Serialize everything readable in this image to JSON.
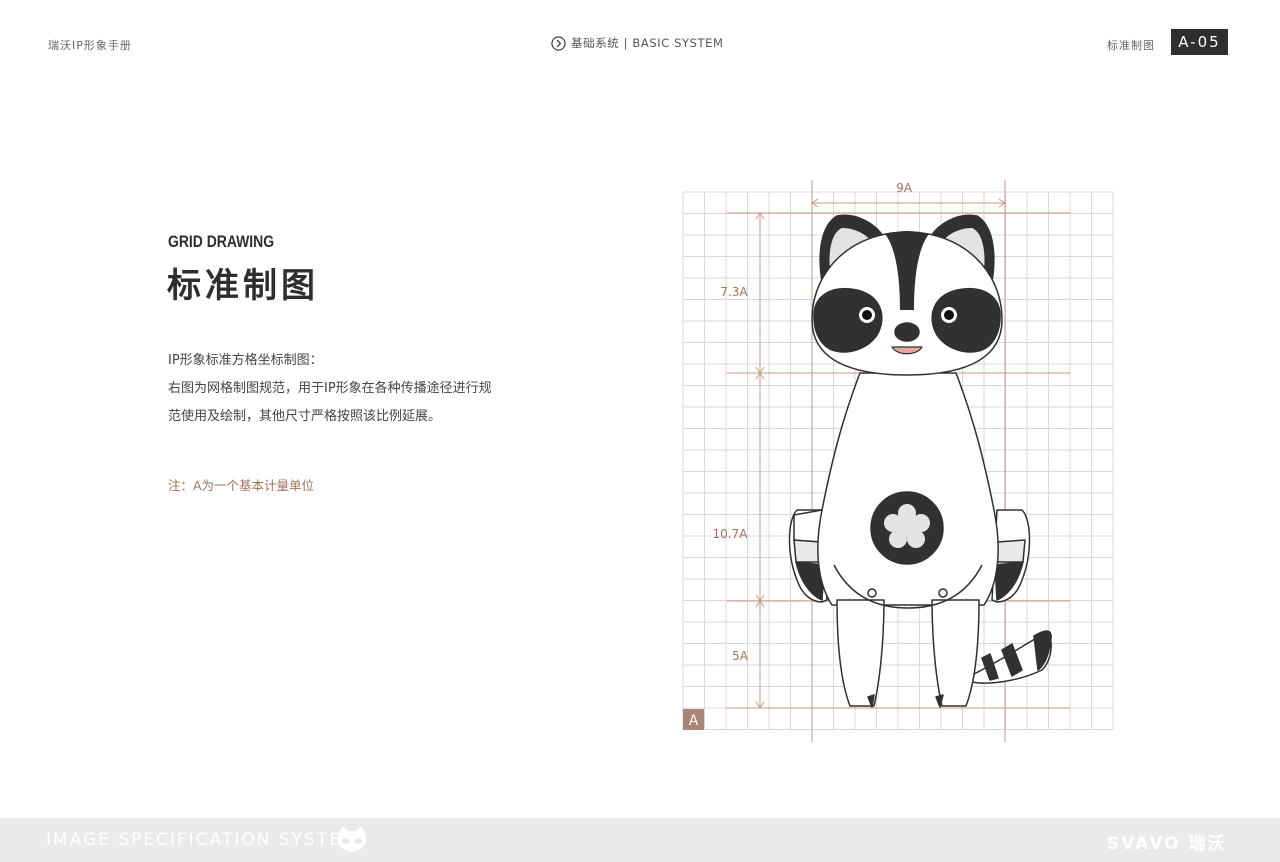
{
  "header": {
    "brand_manual": "瑞沃IP形象手册",
    "section": "基础系统 | BASIC SYSTEM",
    "page_label": "标准制图",
    "page_code": "A-05"
  },
  "main": {
    "title_en": "GRID DRAWING",
    "title_cn": "标准制图",
    "description": [
      "IP形象标准方格坐标制图：",
      "右图为网格制图规范，用于IP形象在各种传播途径进行规",
      "范使用及绘制，其他尺寸严格按照该比例延展。"
    ],
    "note": "注：A为一个基本计量单位"
  },
  "figure": {
    "width_label": "9A",
    "height_labels": [
      "7.3A",
      "10.7A",
      "5A"
    ],
    "unit_label": "A"
  },
  "footer": {
    "left_text": "IMAGE SPECIFICATION SYSTEM",
    "brand": "SVAVO 瑞沃"
  },
  "colors": {
    "accent": "#a07360",
    "grid": "#d6d6d6",
    "guide": "#c49b88",
    "dark": "#2f3230",
    "footer_bg": "#e9eaea"
  }
}
